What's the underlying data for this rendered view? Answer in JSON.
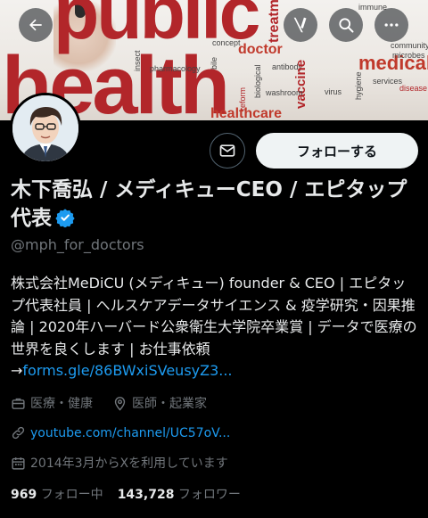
{
  "banner": {
    "word_public": "public",
    "word_health": "health",
    "word_medical": "medical",
    "word_healthcare": "healthcare",
    "word_doctor": "doctor",
    "small_words": [
      "insect",
      "pharmacology",
      "concept",
      "treatment",
      "reform",
      "antibody",
      "vaccine",
      "virus",
      "washroom",
      "biological",
      "bile",
      "community",
      "microbes",
      "services",
      "disease",
      "immune",
      "hygiene"
    ]
  },
  "nav": {
    "back_icon": "arrow-left-icon",
    "grok_icon": "grok-icon",
    "search_icon": "search-icon",
    "more_icon": "more-icon"
  },
  "actions": {
    "message_icon": "envelope-icon",
    "follow_label": "フォローする"
  },
  "profile": {
    "display_name": "木下喬弘 / メディキューCEO / エピタップ代表",
    "handle": "@mph_for_doctors",
    "bio_text": "株式会社MeDiCU (メディキュー) founder & CEO | エピタップ代表社員 | ヘルスケアデータサイエンス & 疫学研究・因果推論 | 2020年ハーバード公衆衛生大学院卒業賞 | データで医療の世界を良くします | お仕事依頼 →",
    "bio_link": "forms.gle/86BWxiSVeusyZ3...",
    "category": "医療・健康",
    "location": "医師・起業家",
    "website": "youtube.com/channel/UC57oV...",
    "joined": "2014年3月からXを利用しています",
    "following_count": "969",
    "following_label": "フォロー中",
    "followers_count": "143,728",
    "followers_label": "フォロワー"
  },
  "colors": {
    "background": "#000000",
    "text": "#e7e9ea",
    "secondary": "#71767b",
    "accent": "#1d9bf0",
    "follow_bg": "#eff3f4",
    "banner_red": "#b2262a"
  }
}
